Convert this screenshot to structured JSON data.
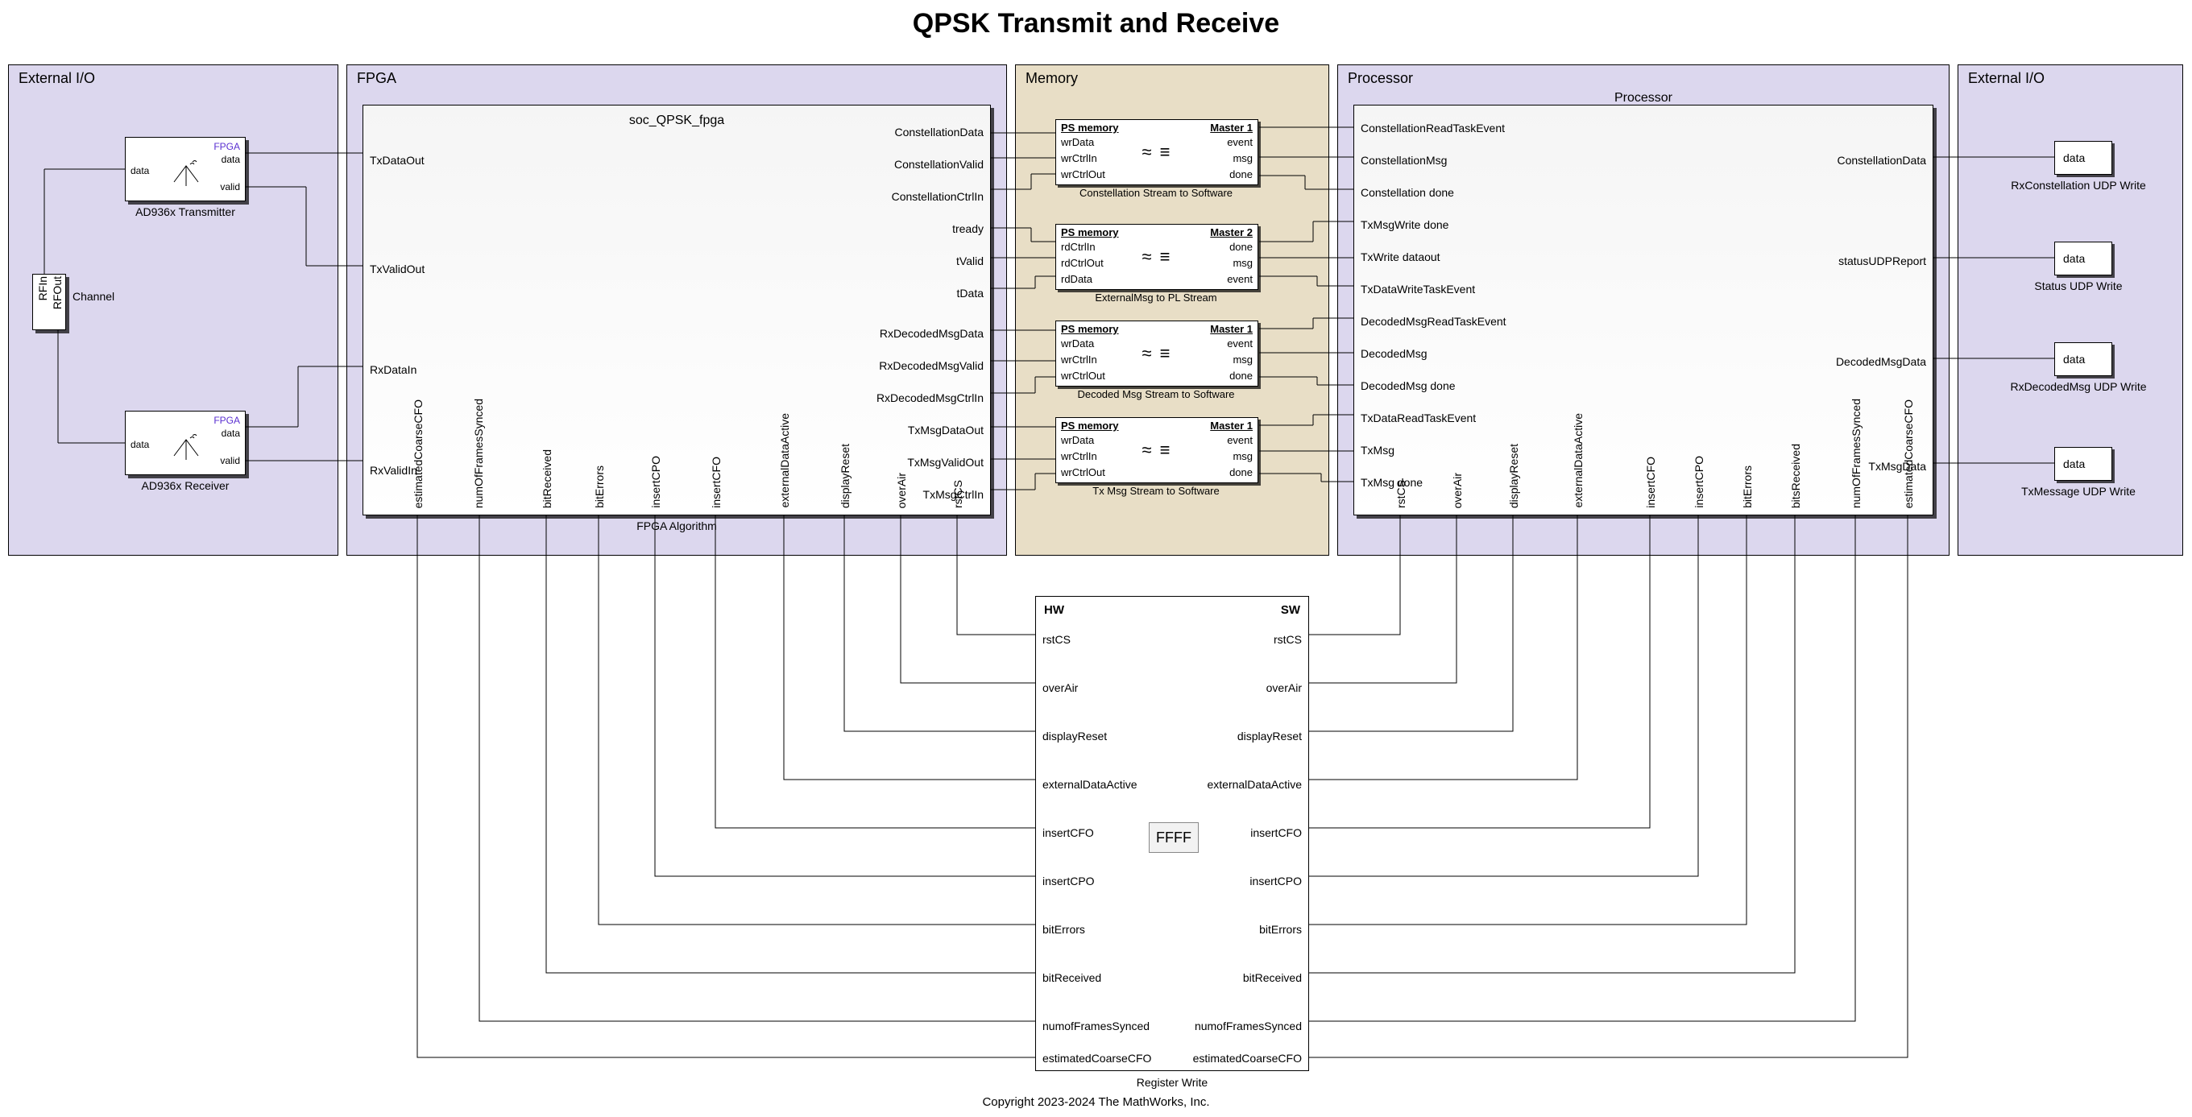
{
  "title": "QPSK Transmit and Receive",
  "copyright": "Copyright 2023-2024 The MathWorks, Inc.",
  "sections": {
    "ext_io_left": "External I/O",
    "fpga": "FPGA",
    "memory": "Memory",
    "processor": "Processor",
    "ext_io_right": "External I/O"
  },
  "ext_left": {
    "tx_block_label": "AD936x Transmitter",
    "rx_block_label": "AD936x Receiver",
    "data": "data",
    "valid": "valid",
    "fpga": "FPGA",
    "channel": "Channel",
    "rfin": "RFIn",
    "rfout": "RFOut"
  },
  "fpga": {
    "block_title": "soc_QPSK_fpga",
    "block_footer": "FPGA Algorithm",
    "left_ports": [
      "TxDataOut",
      "TxValidOut",
      "RxDataIn",
      "RxValidIn"
    ],
    "right_ports": [
      "ConstellationData",
      "ConstellationValid",
      "ConstellationCtrlIn",
      "tready",
      "tValid",
      "tData",
      "RxDecodedMsgData",
      "RxDecodedMsgValid",
      "RxDecodedMsgCtrlIn",
      "TxMsgDataOut",
      "TxMsgValidOut",
      "TxMsgCtrlIn"
    ],
    "bottom_ports": [
      "estimatedCoarseCFO",
      "numOfFramesSynced",
      "bitReceived",
      "bitErrors",
      "insertCPO",
      "insertCFO",
      "externalDataActive",
      "displayReset",
      "overAir",
      "rstCS"
    ]
  },
  "memory": {
    "boxes": [
      {
        "hdr_l": "PS memory",
        "hdr_r": "Master 1",
        "rows": [
          [
            "wrData",
            "event"
          ],
          [
            "wrCtrlIn",
            "msg"
          ],
          [
            "wrCtrlOut",
            "done"
          ]
        ],
        "cap": "Constellation Stream to Software"
      },
      {
        "hdr_l": "PS memory",
        "hdr_r": "Master 2",
        "rows": [
          [
            "rdCtrlIn",
            "done"
          ],
          [
            "rdCtrlOut",
            "msg"
          ],
          [
            "rdData",
            "event"
          ]
        ],
        "cap": "ExternalMsg to PL Stream"
      },
      {
        "hdr_l": "PS memory",
        "hdr_r": "Master 1",
        "rows": [
          [
            "wrData",
            "event"
          ],
          [
            "wrCtrlIn",
            "msg"
          ],
          [
            "wrCtrlOut",
            "done"
          ]
        ],
        "cap": "Decoded Msg Stream to Software"
      },
      {
        "hdr_l": "PS memory",
        "hdr_r": "Master 1",
        "rows": [
          [
            "wrData",
            "event"
          ],
          [
            "wrCtrlIn",
            "msg"
          ],
          [
            "wrCtrlOut",
            "done"
          ]
        ],
        "cap": "Tx Msg Stream to Software"
      }
    ],
    "glyph": "≈ ≡"
  },
  "processor": {
    "block_title": "Processor",
    "left_ports": [
      "ConstellationReadTaskEvent",
      "ConstellationMsg",
      "Constellation done",
      "TxMsgWrite done",
      "TxWrite dataout",
      "TxDataWriteTaskEvent",
      "DecodedMsgReadTaskEvent",
      "DecodedMsg",
      "DecodedMsg done",
      "TxDataReadTaskEvent",
      "TxMsg",
      "TxMsg done"
    ],
    "right_ports": [
      "ConstellationData",
      "statusUDPReport",
      "DecodedMsgData",
      "TxMsgData"
    ],
    "bottom_ports": [
      "rstCS",
      "overAir",
      "displayReset",
      "externalDataActive",
      "insertCFO",
      "insertCPO",
      "bitErrors",
      "bitsReceived",
      "numOfFramesSynced",
      "estimatedCoarseCFO"
    ]
  },
  "ext_right": {
    "data": "data",
    "sinks": [
      "RxConstellation UDP Write",
      "Status UDP Write",
      "RxDecodedMsg UDP Write",
      "TxMessage UDP Write"
    ]
  },
  "register": {
    "hw": "HW",
    "sw": "SW",
    "cap": "Register Write",
    "ffff": "FFFF",
    "rows": [
      "rstCS",
      "overAir",
      "displayReset",
      "externalDataActive",
      "insertCFO",
      "insertCPO",
      "bitErrors",
      "bitReceived",
      "numofFramesSynced",
      "estimatedCoarseCFO"
    ]
  }
}
